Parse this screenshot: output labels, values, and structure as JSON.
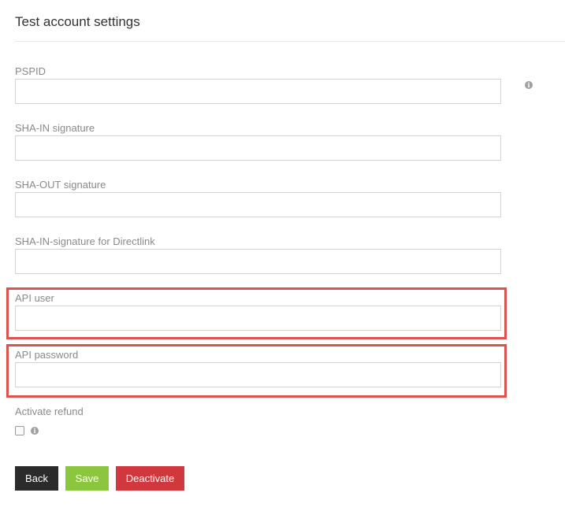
{
  "page": {
    "title": "Test account settings"
  },
  "fields": [
    {
      "label": "PSPID",
      "value": ""
    },
    {
      "label": "SHA-IN signature",
      "value": ""
    },
    {
      "label": "SHA-OUT signature",
      "value": ""
    },
    {
      "label": "SHA-IN-signature for Directlink",
      "value": ""
    },
    {
      "label": "API user",
      "value": ""
    },
    {
      "label": "API password",
      "value": ""
    }
  ],
  "refund": {
    "label": "Activate refund",
    "checked": false
  },
  "icons": {
    "info": "info-icon"
  },
  "info_glyph": "i",
  "buttons": {
    "back": "Back",
    "save": "Save",
    "deactivate": "Deactivate"
  },
  "colors": {
    "highlight": "#d9534f",
    "back": "#2b2b2b",
    "save": "#8cc63f",
    "deactivate": "#d0383e"
  }
}
